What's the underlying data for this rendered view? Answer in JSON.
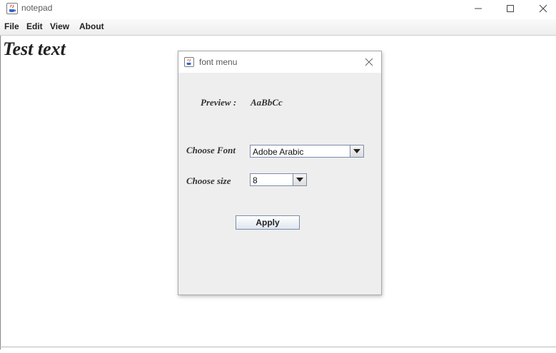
{
  "window": {
    "title": "notepad"
  },
  "menubar": {
    "items": [
      "File",
      "Edit",
      "View",
      "About"
    ]
  },
  "editor": {
    "text": "Test text"
  },
  "dialog": {
    "title": "font menu",
    "preview_label": "Preview :",
    "preview_sample": "AaBbCc",
    "font_label": "Choose Font",
    "font_value": "Adobe Arabic",
    "size_label": "Choose size",
    "size_value": "8",
    "apply_label": "Apply"
  }
}
